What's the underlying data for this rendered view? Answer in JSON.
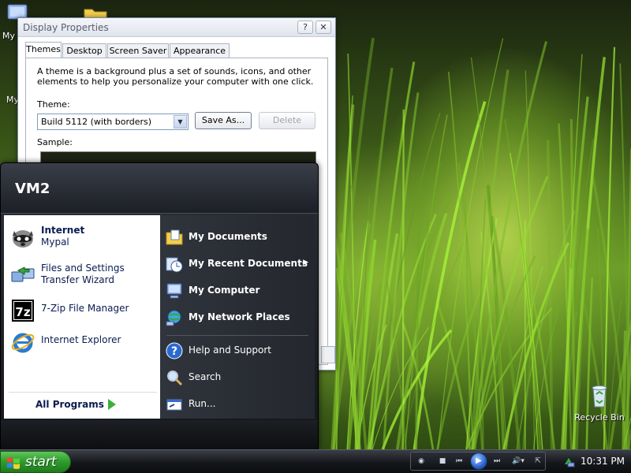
{
  "desktop": {
    "partial_labels": {
      "my_top": "My",
      "my_mid": "My"
    },
    "recycle_bin_label": "Recycle Bin"
  },
  "display_properties": {
    "title": "Display Properties",
    "help_glyph": "?",
    "close_glyph": "✕",
    "tabs": [
      {
        "label": "Themes",
        "active": true
      },
      {
        "label": "Desktop",
        "active": false
      },
      {
        "label": "Screen Saver",
        "active": false
      },
      {
        "label": "Appearance",
        "active": false
      }
    ],
    "description": "A theme is a background plus a set of sounds, icons, and other elements to help you personalize your computer with one click.",
    "theme_label": "Theme:",
    "theme_value": "Build 5112 (with borders)",
    "save_as_label": "Save As...",
    "delete_label": "Delete",
    "sample_label": "Sample:"
  },
  "start_menu": {
    "user_name": "VM2",
    "pinned": [
      {
        "title": "Internet",
        "subtitle": "Mypal",
        "icon": "mypal-raccoon-icon"
      },
      {
        "title": "Files and Settings Transfer Wizard",
        "subtitle": "",
        "icon": "transfer-wizard-icon"
      },
      {
        "title": "7-Zip File Manager",
        "subtitle": "",
        "icon": "7zip-icon"
      },
      {
        "title": "Internet Explorer",
        "subtitle": "",
        "icon": "internet-explorer-icon"
      }
    ],
    "all_programs_label": "All Programs",
    "places": [
      {
        "label": "My Documents",
        "icon": "my-documents-icon",
        "bold": true,
        "has_submenu": false
      },
      {
        "label": "My Recent Documents",
        "icon": "recent-documents-icon",
        "bold": true,
        "has_submenu": true
      },
      {
        "label": "My Computer",
        "icon": "my-computer-icon",
        "bold": true,
        "has_submenu": false
      },
      {
        "label": "My Network Places",
        "icon": "network-places-icon",
        "bold": true,
        "has_submenu": false
      },
      {
        "label": "Help and Support",
        "icon": "help-icon",
        "bold": false,
        "has_submenu": false
      },
      {
        "label": "Search",
        "icon": "search-icon",
        "bold": false,
        "has_submenu": false
      },
      {
        "label": "Run...",
        "icon": "run-icon",
        "bold": false,
        "has_submenu": false
      }
    ],
    "submenu_arrow": "▶"
  },
  "taskbar": {
    "start_label": "start",
    "clock": "10:31 PM",
    "media_buttons": {
      "stop": "■",
      "prev": "⏮",
      "play": "▶",
      "next": "⏭",
      "volume": "🔊▾"
    }
  },
  "colors": {
    "start_green": "#2e9a2c",
    "menu_dark": "#24272d",
    "link_blue": "#0b1b50"
  }
}
